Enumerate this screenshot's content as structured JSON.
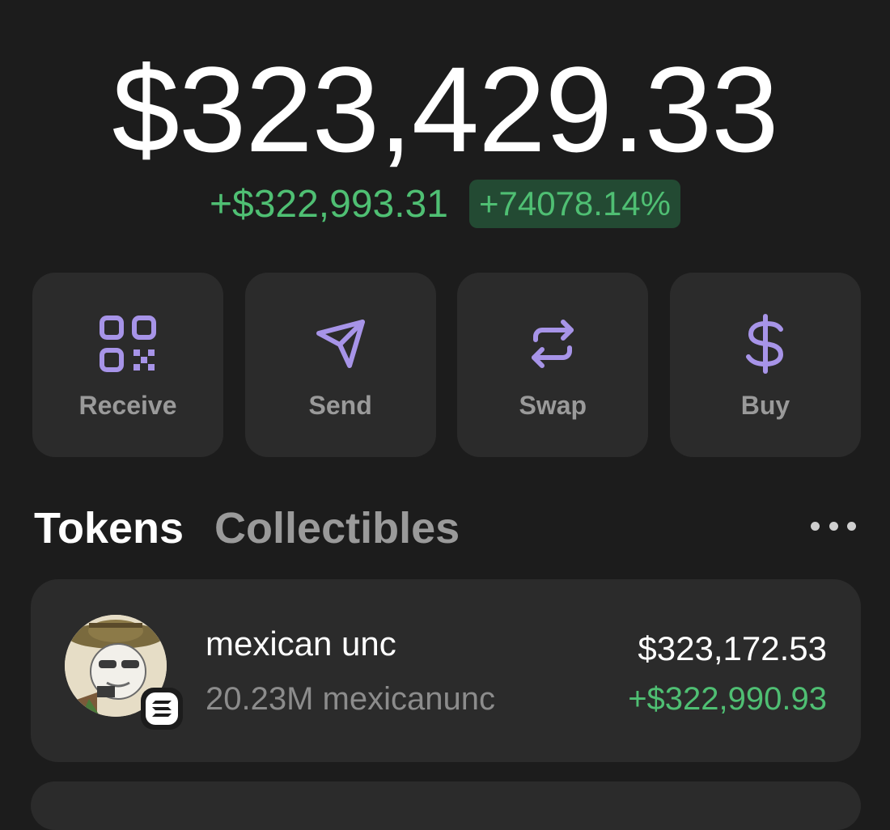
{
  "wallet": {
    "balance": "$323,429.33",
    "change_amount": "+$322,993.31",
    "change_percent": "+74078.14%"
  },
  "actions": [
    {
      "label": "Receive",
      "icon": "qr-code-icon"
    },
    {
      "label": "Send",
      "icon": "send-icon"
    },
    {
      "label": "Swap",
      "icon": "swap-icon"
    },
    {
      "label": "Buy",
      "icon": "dollar-icon"
    }
  ],
  "tabs": {
    "active": "Tokens",
    "inactive": "Collectibles"
  },
  "tokens": [
    {
      "name": "mexican unc",
      "amount": "20.23M mexicanunc",
      "value": "$323,172.53",
      "change": "+$322,990.93",
      "chain_icon": "solana-icon"
    }
  ],
  "colors": {
    "background": "#1c1c1c",
    "card": "#2b2b2b",
    "positive": "#4fbf73",
    "positive_badge": "#234a33",
    "icon_accent": "#a794e8",
    "muted_text": "#9a9a9a"
  }
}
